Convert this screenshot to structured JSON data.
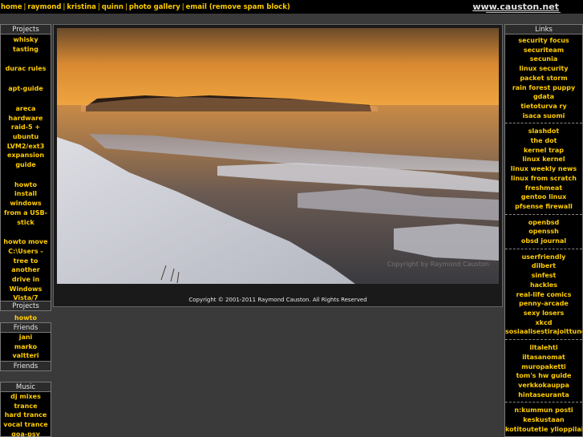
{
  "topnav": {
    "items": [
      "home",
      "raymond",
      "kristina",
      "quinn",
      "photo gallery",
      "email (remove spam block)"
    ],
    "separator": "|"
  },
  "site_name": "www.causton.net",
  "projects": {
    "header": "Projects",
    "footer": "Projects",
    "items": [
      "whisky tasting",
      "durac rules",
      "apt-guide",
      "areca hardware raid-5 + ubuntu LVM2/ext3 expansion guide",
      "howto install windows from a USB-stick",
      "howto move C:\\Users -tree to another drive in Windows Vista/7",
      "howto convert any song to a iPhone ringtone"
    ]
  },
  "friends": {
    "header": "Friends",
    "footer": "Friends",
    "items": [
      "jani",
      "marko",
      "valtteri"
    ]
  },
  "music": {
    "header": "Music",
    "items": [
      "dj mixes",
      "trance",
      "hard trance",
      "vocal trance",
      "goa-psy trance"
    ]
  },
  "links": {
    "header": "Links",
    "groups": [
      [
        "security focus",
        "securiteam",
        "secunia",
        "linux security",
        "packet storm",
        "rain forest puppy",
        "gdata",
        "tietoturva ry",
        "isaca suomi"
      ],
      [
        "slashdot",
        "the dot",
        "kernel trap",
        "linux kernel",
        "linux weekly news",
        "linux from scratch",
        "freshmeat",
        "gentoo linux",
        "pfsense firewall"
      ],
      [
        "openbsd",
        "openssh",
        "obsd journal"
      ],
      [
        "userfriendly",
        "dilbert",
        "sinfest",
        "hackles",
        "real-life comics",
        "penny-arcade",
        "sexy losers",
        "xkcd",
        "sosiaalisestirajoittuneet"
      ],
      [
        "iltalehti",
        "iltasanomat",
        "muropaketti",
        "tom's hw guide",
        "verkkokauppa",
        "hintaseuranta"
      ],
      [
        "n:kummun posti",
        "keskustaan",
        "kotitoutetie ylioppilaiksi"
      ]
    ]
  },
  "photo": {
    "copyright": "Copyright © 2001-2011 Raymond Causton. All Rights Reserved",
    "watermark": "Copyright by Raymond Causton"
  },
  "colors": {
    "accent": "#ffcc00",
    "background": "#3a3a3a",
    "panel": "#000000"
  }
}
